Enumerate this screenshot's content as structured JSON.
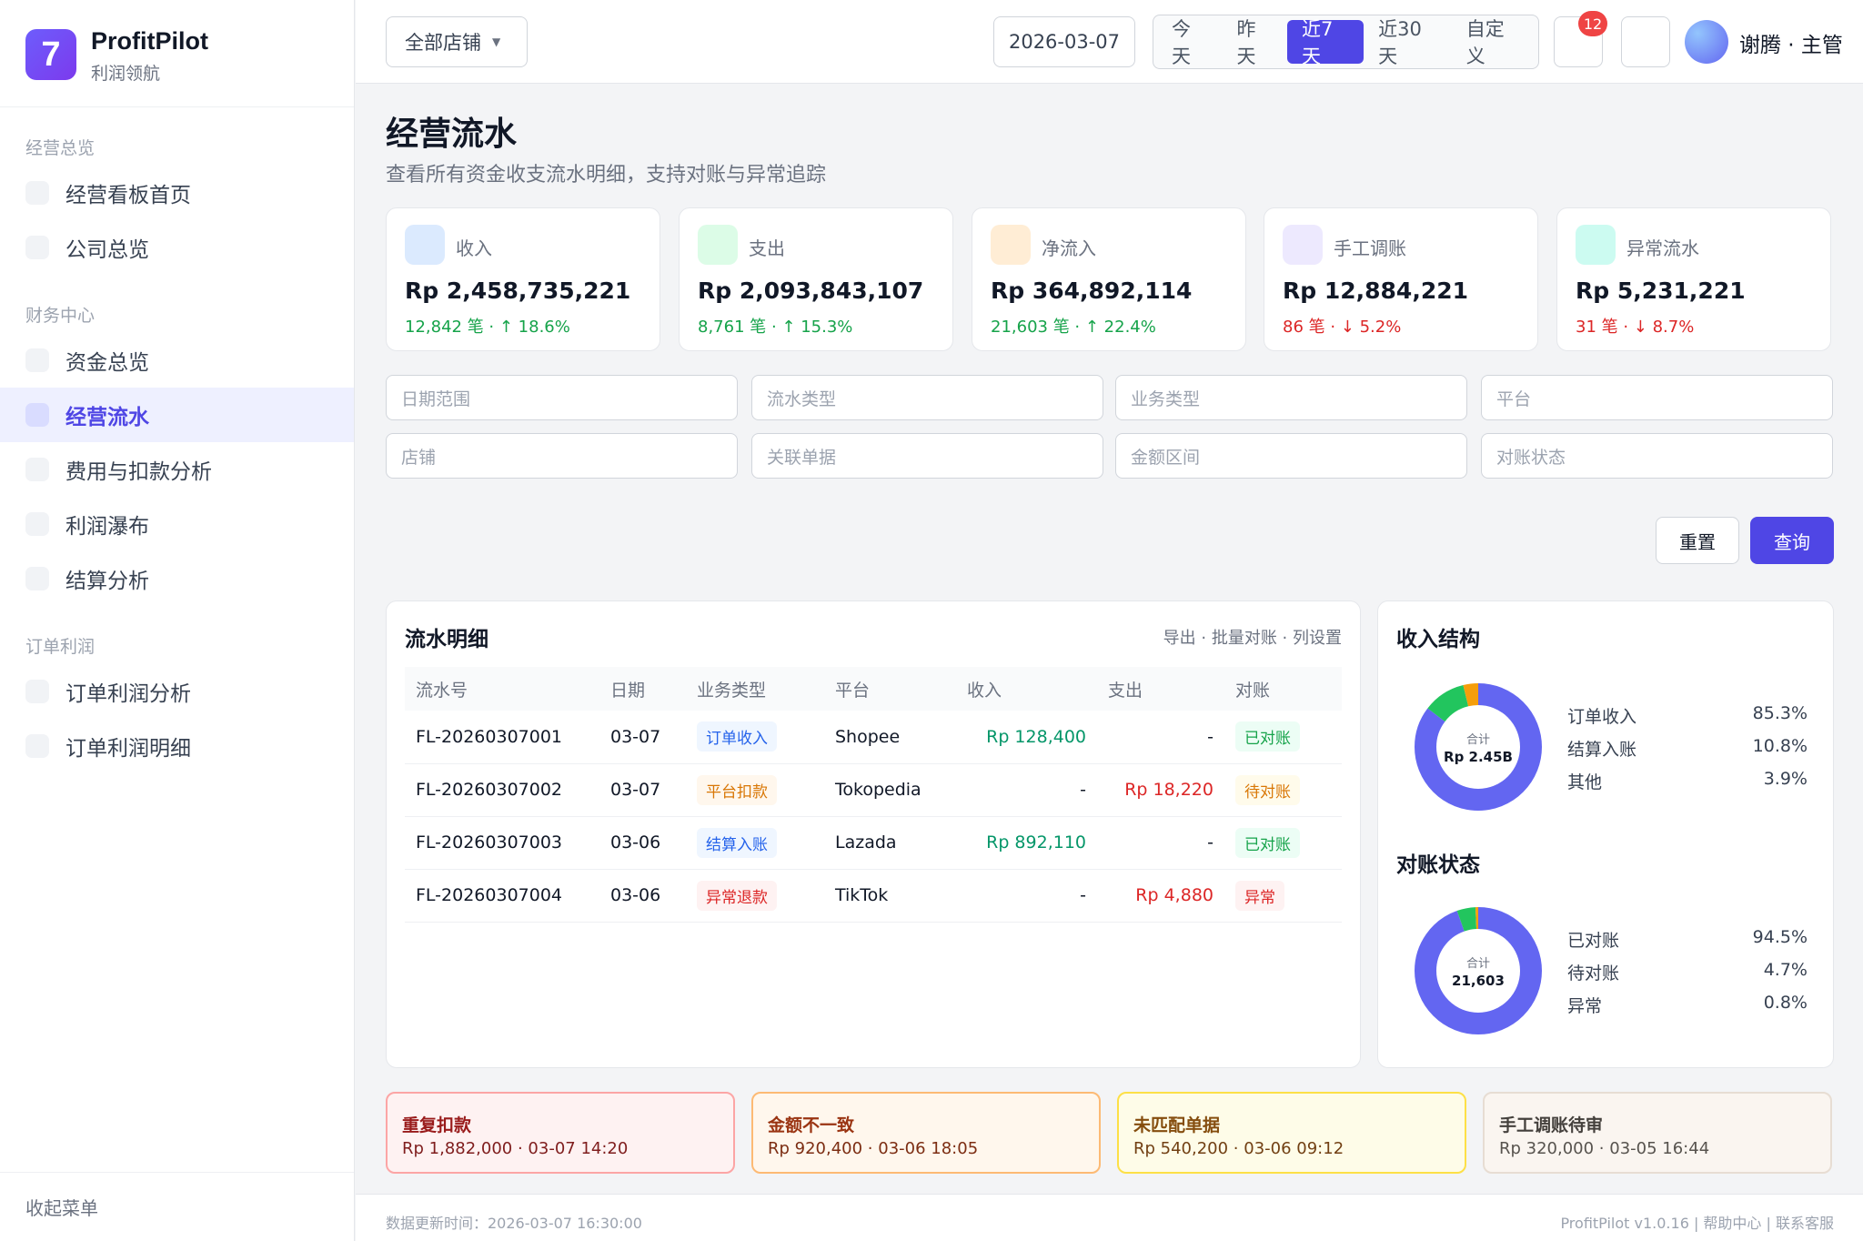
{
  "brand": {
    "logo": "7",
    "name": "ProfitPilot",
    "subtitle": "利润领航"
  },
  "sidebar": {
    "groups": [
      "经营总览",
      "财务中心",
      "订单利润"
    ],
    "items": [
      "经营看板首页",
      "公司总览",
      "资金总览",
      "经营流水",
      "费用与扣款分析",
      "利润瀑布",
      "结算分析",
      "订单利润分析",
      "订单利润明细"
    ],
    "active": "经营流水",
    "collapse": "收起菜单"
  },
  "topbar": {
    "store_select": "全部店铺",
    "date": "2026-03-07",
    "ranges": [
      "今天",
      "昨天",
      "近7天",
      "近30天",
      "自定义"
    ],
    "active_range": "近7天",
    "notification_count": "12",
    "user": "谢腾 · 主管"
  },
  "page": {
    "title": "经营流水",
    "subtitle": "查看所有资金收支流水明细，支持对账与异常追踪"
  },
  "kpis": [
    {
      "label": "收入",
      "value": "Rp 2,458,735,221",
      "sub": "12,842 笔 · ↑ 18.6%",
      "trend": "up",
      "icon_color": "#dbeafe"
    },
    {
      "label": "支出",
      "value": "Rp 2,093,843,107",
      "sub": "8,761 笔 · ↑ 15.3%",
      "trend": "up",
      "icon_color": "#dcfce7"
    },
    {
      "label": "净流入",
      "value": "Rp 364,892,114",
      "sub": "21,603 笔 · ↑ 22.4%",
      "trend": "up",
      "icon_color": "#ffedd5"
    },
    {
      "label": "手工调账",
      "value": "Rp 12,884,221",
      "sub": "86 笔 · ↓ 5.2%",
      "trend": "down",
      "icon_color": "#ede9fe"
    },
    {
      "label": "异常流水",
      "value": "Rp 5,231,221",
      "sub": "31 笔 · ↓ 8.7%",
      "trend": "down",
      "icon_color": "#ccfbf1"
    }
  ],
  "filters": {
    "placeholders": [
      "日期范围",
      "流水类型",
      "业务类型",
      "平台",
      "店铺",
      "关联单据",
      "金额区间",
      "对账状态"
    ]
  },
  "buttons": {
    "reset": "重置",
    "query": "查询"
  },
  "table": {
    "title": "流水明细",
    "actions": "导出 · 批量对账 · 列设置",
    "headers": [
      "流水号",
      "日期",
      "业务类型",
      "平台",
      "收入",
      "支出",
      "对账"
    ],
    "rows": [
      {
        "id": "FL-20260307001",
        "date": "03-07",
        "type": "订单收入",
        "type_style": "blue",
        "platform": "Shopee",
        "income": "Rp 128,400",
        "expense": "-",
        "status": "已对账",
        "status_style": "green"
      },
      {
        "id": "FL-20260307002",
        "date": "03-07",
        "type": "平台扣款",
        "type_style": "orange",
        "platform": "Tokopedia",
        "income": "-",
        "expense": "Rp 18,220",
        "status": "待对账",
        "status_style": "amber"
      },
      {
        "id": "FL-20260307003",
        "date": "03-06",
        "type": "结算入账",
        "type_style": "blue",
        "platform": "Lazada",
        "income": "Rp 892,110",
        "expense": "-",
        "status": "已对账",
        "status_style": "green"
      },
      {
        "id": "FL-20260307004",
        "date": "03-06",
        "type": "异常退款",
        "type_style": "red",
        "platform": "TikTok",
        "income": "-",
        "expense": "Rp 4,880",
        "status": "异常",
        "status_style": "red"
      }
    ]
  },
  "income_structure": {
    "title": "收入结构",
    "center_label": "合计",
    "center_value": "Rp 2.45B",
    "items": [
      {
        "name": "订单收入",
        "pct": "85.3%",
        "value": 85.3,
        "color": "#6366f1"
      },
      {
        "name": "结算入账",
        "pct": "10.8%",
        "value": 10.8,
        "color": "#22c55e"
      },
      {
        "name": "其他",
        "pct": "3.9%",
        "value": 3.9,
        "color": "#f59e0b"
      }
    ]
  },
  "reconcile_status": {
    "title": "对账状态",
    "center_label": "合计",
    "center_value": "21,603",
    "items": [
      {
        "name": "已对账",
        "pct": "94.5%",
        "value": 94.5,
        "color": "#6366f1"
      },
      {
        "name": "待对账",
        "pct": "4.7%",
        "value": 4.7,
        "color": "#22c55e"
      },
      {
        "name": "异常",
        "pct": "0.8%",
        "value": 0.8,
        "color": "#f59e0b"
      }
    ]
  },
  "alerts": [
    {
      "title": "重复扣款",
      "detail": "Rp 1,882,000 · 03-07 14:20"
    },
    {
      "title": "金额不一致",
      "detail": "Rp 920,400 · 03-06 18:05"
    },
    {
      "title": "未匹配单据",
      "detail": "Rp 540,200 · 03-06 09:12"
    },
    {
      "title": "手工调账待审",
      "detail": "Rp 320,000 · 03-05 16:44"
    }
  ],
  "footer": {
    "updated": "数据更新时间：2026-03-07 16:30:00",
    "version": "ProfitPilot v1.0.16 | 帮助中心 | 联系客服"
  }
}
